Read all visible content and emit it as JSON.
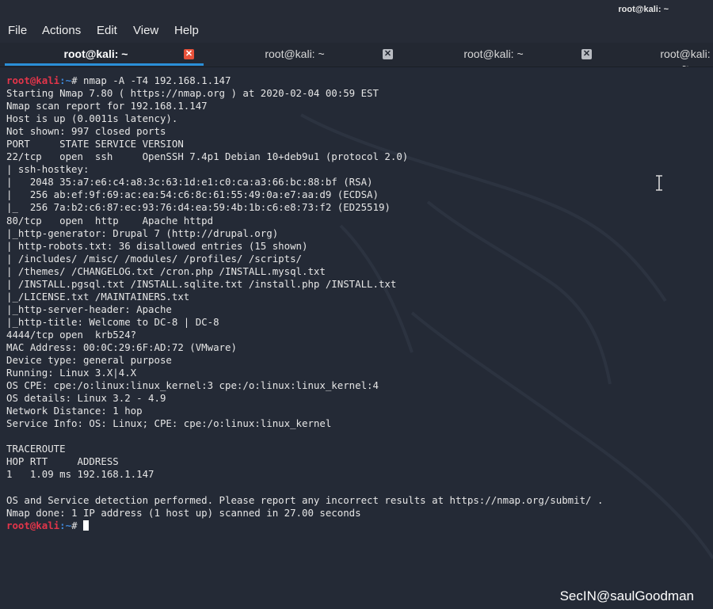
{
  "window": {
    "title": "root@kali: ~"
  },
  "menu": [
    "File",
    "Actions",
    "Edit",
    "View",
    "Help"
  ],
  "tabs": [
    {
      "label": "root@kali: ~",
      "active": true
    },
    {
      "label": "root@kali: ~",
      "active": false
    },
    {
      "label": "root@kali: ~",
      "active": false
    },
    {
      "label": "root@kali: ~",
      "active": false
    }
  ],
  "prompt": {
    "user": "root@kali",
    "path": ":~",
    "symbol": "# "
  },
  "command": "nmap -A -T4 192.168.1.147",
  "output": [
    "Starting Nmap 7.80 ( https://nmap.org ) at 2020-02-04 00:59 EST",
    "Nmap scan report for 192.168.1.147",
    "Host is up (0.0011s latency).",
    "Not shown: 997 closed ports",
    "PORT     STATE SERVICE VERSION",
    "22/tcp   open  ssh     OpenSSH 7.4p1 Debian 10+deb9u1 (protocol 2.0)",
    "| ssh-hostkey:",
    "|   2048 35:a7:e6:c4:a8:3c:63:1d:e1:c0:ca:a3:66:bc:88:bf (RSA)",
    "|   256 ab:ef:9f:69:ac:ea:54:c6:8c:61:55:49:0a:e7:aa:d9 (ECDSA)",
    "|_  256 7a:b2:c6:87:ec:93:76:d4:ea:59:4b:1b:c6:e8:73:f2 (ED25519)",
    "80/tcp   open  http    Apache httpd",
    "|_http-generator: Drupal 7 (http://drupal.org)",
    "| http-robots.txt: 36 disallowed entries (15 shown)",
    "| /includes/ /misc/ /modules/ /profiles/ /scripts/",
    "| /themes/ /CHANGELOG.txt /cron.php /INSTALL.mysql.txt",
    "| /INSTALL.pgsql.txt /INSTALL.sqlite.txt /install.php /INSTALL.txt",
    "|_/LICENSE.txt /MAINTAINERS.txt",
    "|_http-server-header: Apache",
    "|_http-title: Welcome to DC-8 | DC-8",
    "4444/tcp open  krb524?",
    "MAC Address: 00:0C:29:6F:AD:72 (VMware)",
    "Device type: general purpose",
    "Running: Linux 3.X|4.X",
    "OS CPE: cpe:/o:linux:linux_kernel:3 cpe:/o:linux:linux_kernel:4",
    "OS details: Linux 3.2 - 4.9",
    "Network Distance: 1 hop",
    "Service Info: OS: Linux; CPE: cpe:/o:linux:linux_kernel",
    "",
    "TRACEROUTE",
    "HOP RTT     ADDRESS",
    "1   1.09 ms 192.168.1.147",
    "",
    "OS and Service detection performed. Please report any incorrect results at https://nmap.org/submit/ .",
    "Nmap done: 1 IP address (1 host up) scanned in 27.00 seconds"
  ],
  "watermark": "SecIN@saulGoodman",
  "colors": {
    "background": "#242a36",
    "prompt_user": "#e3354a",
    "prompt_path": "#3f86d6",
    "active_tab_underline": "#2a8fd8",
    "close_active": "#e8513a"
  }
}
